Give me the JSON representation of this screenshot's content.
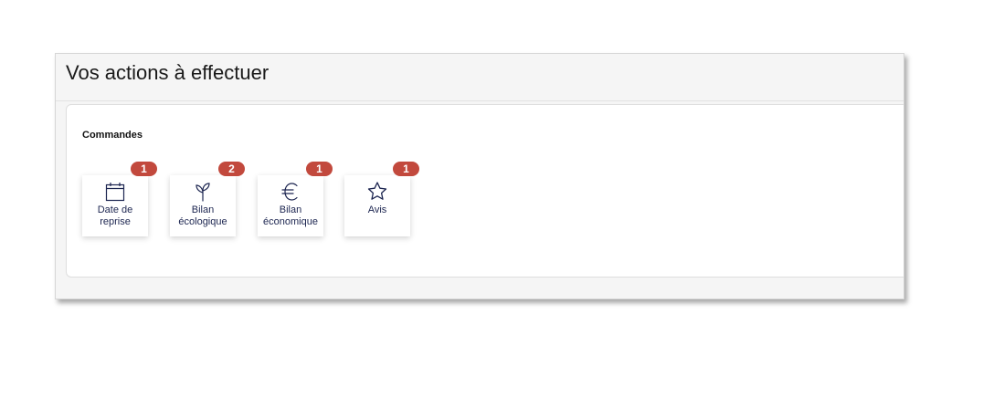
{
  "actions_panel": {
    "title": "Vos actions à effectuer",
    "section_label": "Commandes",
    "tiles": [
      {
        "label": "Date de\nreprise",
        "badge": "1",
        "icon": "calendar-icon"
      },
      {
        "label": "Bilan\nécologique",
        "badge": "2",
        "icon": "sprout-icon"
      },
      {
        "label": "Bilan\néconomique",
        "badge": "1",
        "icon": "euro-icon"
      },
      {
        "label": "Avis",
        "badge": "1",
        "icon": "star-icon"
      }
    ]
  },
  "colors": {
    "badge": "#c2493d",
    "icon_stroke": "#1c2550",
    "panel_bg": "#f5f5f5"
  }
}
